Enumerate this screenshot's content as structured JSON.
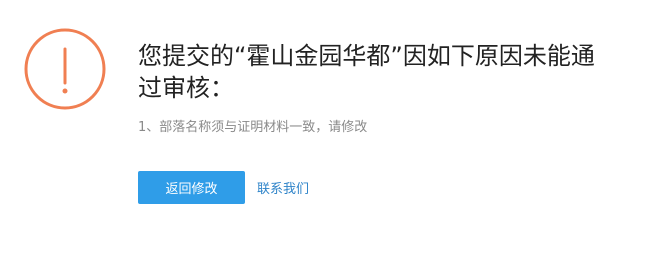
{
  "message": {
    "title": "您提交的“霍山金园华都”因如下原因未能通过审核：",
    "reason": "1、部落名称须与证明材料一致，请修改"
  },
  "actions": {
    "primary_label": "返回修改",
    "link_label": "联系我们"
  },
  "icons": {
    "warning": "exclamation-circle-icon"
  },
  "colors": {
    "warning": "#f07f52",
    "primary": "#2f9de8",
    "link": "#2f84c9",
    "title": "#222222",
    "reason": "#8a8a8a"
  }
}
